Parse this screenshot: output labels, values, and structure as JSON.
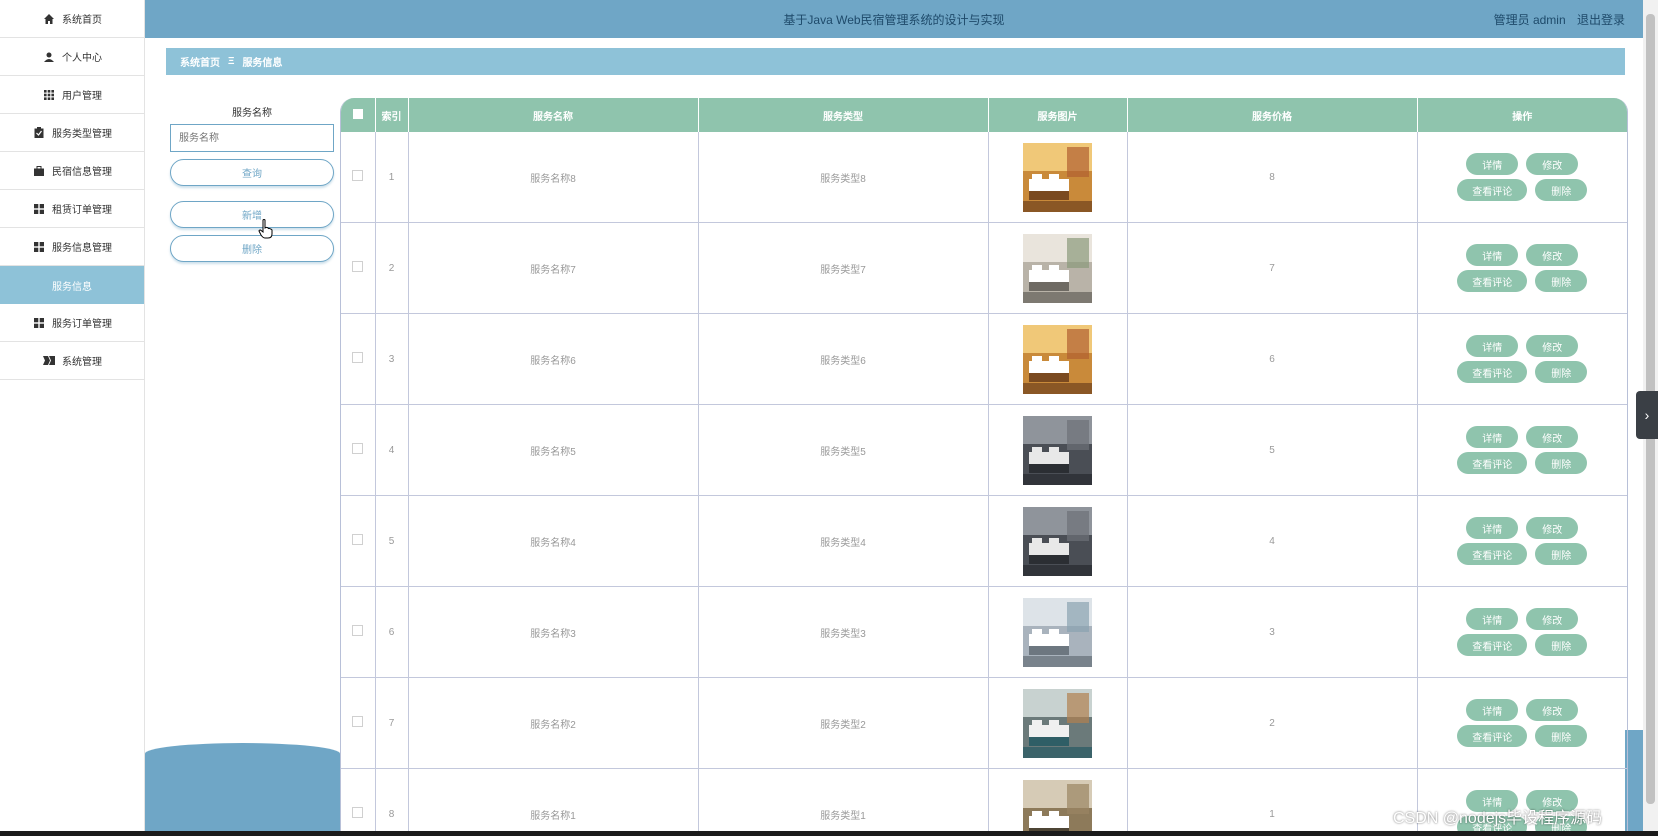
{
  "sidebar": {
    "items": [
      {
        "label": "系统首页",
        "icon": "home-icon"
      },
      {
        "label": "个人中心",
        "icon": "user-icon"
      },
      {
        "label": "用户管理",
        "icon": "grid-icon"
      },
      {
        "label": "服务类型管理",
        "icon": "clipboard-icon"
      },
      {
        "label": "民宿信息管理",
        "icon": "briefcase-icon"
      },
      {
        "label": "租赁订单管理",
        "icon": "apps-icon"
      },
      {
        "label": "服务信息管理",
        "icon": "apps-icon"
      },
      {
        "label": "服务信息",
        "icon": "",
        "active": true
      },
      {
        "label": "服务订单管理",
        "icon": "apps-icon"
      },
      {
        "label": "系统管理",
        "icon": "system-icon"
      }
    ]
  },
  "header": {
    "title": "基于Java Web民宿管理系统的设计与实现",
    "user": "管理员 admin",
    "logout": "退出登录"
  },
  "breadcrumb": {
    "home": "系统首页",
    "separator": "Ξ",
    "current": "服务信息"
  },
  "search": {
    "label": "服务名称",
    "placeholder": "服务名称",
    "query_button": "查询",
    "add_button": "新增",
    "delete_button": "删除"
  },
  "table": {
    "headers": [
      "索引",
      "服务名称",
      "服务类型",
      "服务图片",
      "服务价格",
      "操作"
    ],
    "rows": [
      {
        "index": "1",
        "name": "服务名称8",
        "type": "服务类型8",
        "price": "8",
        "image": "hotel-room-warm"
      },
      {
        "index": "2",
        "name": "服务名称7",
        "type": "服务类型7",
        "price": "7",
        "image": "hotel-room-window"
      },
      {
        "index": "3",
        "name": "服务名称6",
        "type": "服务类型6",
        "price": "6",
        "image": "hotel-room-warm"
      },
      {
        "index": "4",
        "name": "服务名称5",
        "type": "服务类型5",
        "price": "5",
        "image": "hotel-room-dark"
      },
      {
        "index": "5",
        "name": "服务名称4",
        "type": "服务类型4",
        "price": "4",
        "image": "hotel-room-dark"
      },
      {
        "index": "6",
        "name": "服务名称3",
        "type": "服务类型3",
        "price": "3",
        "image": "hotel-room-bright"
      },
      {
        "index": "7",
        "name": "服务名称2",
        "type": "服务类型2",
        "price": "2",
        "image": "hotel-room-teal"
      },
      {
        "index": "8",
        "name": "服务名称1",
        "type": "服务类型1",
        "price": "1",
        "image": "hotel-corridor"
      }
    ],
    "actions": {
      "detail": "详情",
      "edit": "修改",
      "comments": "查看评论",
      "delete": "删除"
    }
  },
  "watermark": "CSDN @nodejs毕设程序源码",
  "colors": {
    "header": "#6fa6c6",
    "accent": "#8ec2d8",
    "table_head": "#8fc4ad"
  }
}
